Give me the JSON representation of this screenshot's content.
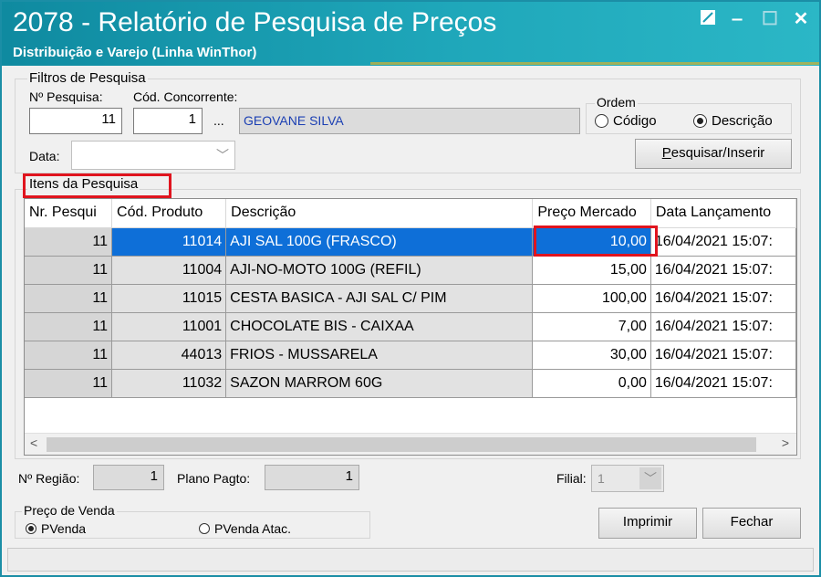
{
  "window": {
    "title": "2078 - Relatório de Pesquisa de Preços",
    "subtitle": "Distribuição e Varejo (Linha WinThor)"
  },
  "filters": {
    "group_label": "Filtros de Pesquisa",
    "pesquisa_label": "Nº Pesquisa:",
    "pesquisa_value": "11",
    "concorrente_label": "Cód. Concorrente:",
    "concorrente_value": "1",
    "ellipsis": "...",
    "concorrente_name": "GEOVANE SILVA",
    "data_label": "Data:",
    "data_value": "",
    "ordem_label": "Ordem",
    "ordem_options": [
      "Código",
      "Descrição"
    ],
    "ordem_selected": "Descrição",
    "search_button": "Pesquisar/Inserir"
  },
  "items": {
    "group_label": "Itens da Pesquisa",
    "columns": [
      "Nr. Pesqui",
      "Cód. Produto",
      "Descrição",
      "Preço Mercado",
      "Data Lançamento"
    ],
    "rows": [
      [
        "11",
        "11014",
        "AJI SAL 100G (FRASCO)",
        "10,00",
        "16/04/2021 15:07:"
      ],
      [
        "11",
        "11004",
        "AJI-NO-MOTO 100G (REFIL)",
        "15,00",
        "16/04/2021 15:07:"
      ],
      [
        "11",
        "11015",
        "CESTA BASICA - AJI SAL C/ PIM",
        "100,00",
        "16/04/2021 15:07:"
      ],
      [
        "11",
        "11001",
        "CHOCOLATE BIS  - CAIXAA",
        "7,00",
        "16/04/2021 15:07:"
      ],
      [
        "11",
        "44013",
        "FRIOS - MUSSARELA",
        "30,00",
        "16/04/2021 15:07:"
      ],
      [
        "11",
        "11032",
        "SAZON MARROM 60G",
        "0,00",
        "16/04/2021 15:07:"
      ]
    ],
    "selected_row": 0
  },
  "footer": {
    "regiao_label": "Nº Região:",
    "regiao_value": "1",
    "plano_label": "Plano Pagto:",
    "plano_value": "1",
    "filial_label": "Filial:",
    "filial_value": "1",
    "preco_group_label": "Preço de Venda",
    "preco_options": [
      "PVenda",
      "PVenda Atac."
    ],
    "preco_selected": "PVenda",
    "print_button": "Imprimir",
    "close_button": "Fechar"
  },
  "colors": {
    "title_bar": "#1fa7ba",
    "selection": "#0e6fd8",
    "highlight_box": "#e0141e"
  }
}
